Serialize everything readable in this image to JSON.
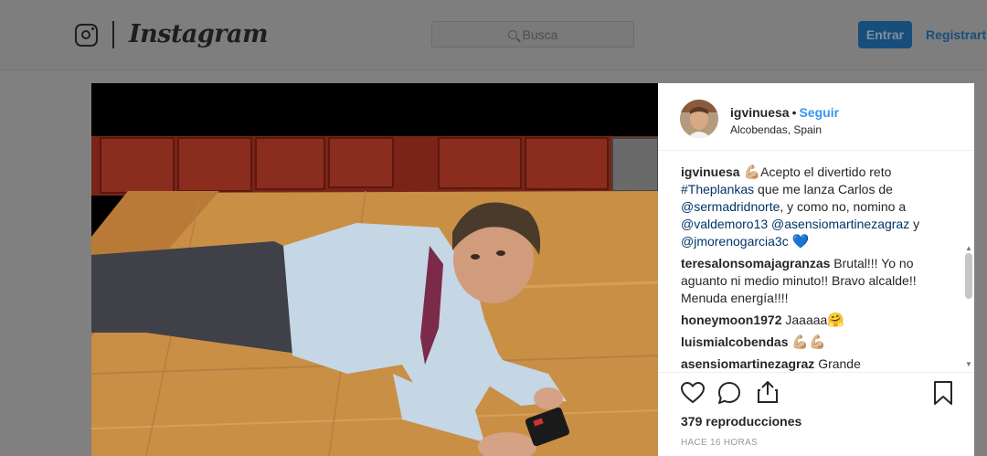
{
  "header": {
    "brand": "Instagram",
    "search_placeholder": "Busca",
    "login_label": "Entrar",
    "register_label": "Registrarte"
  },
  "post": {
    "username": "igvinuesa",
    "separator": "•",
    "follow_label": "Seguir",
    "location": "Alcobendas, Spain",
    "views_count": "379",
    "views_label": "reproducciones",
    "timestamp": "HACE 16 HORAS",
    "caption": {
      "username": "igvinuesa",
      "emoji": "💪🏼",
      "text_1": "Acepto el divertido reto",
      "hashtag": "#Theplankas",
      "text_2": " que me lanza Carlos de",
      "mention_1": "@sermadridnorte",
      "text_3": ", y como no, nomino a",
      "mention_2": "@valdemoro13",
      "mention_3": "@asensiomartinezagraz",
      "text_4": " y",
      "mention_4": "@jmorenogarcia3c",
      "emoji_end": "💙"
    },
    "comments": [
      {
        "username": "teresalonsomajagranzas",
        "text": "Brutal!!! Yo no aguanto ni medio minuto!! Bravo alcalde!! Menuda energía!!!!",
        "emoji": ""
      },
      {
        "username": "honeymoon1972",
        "text": "Jaaaaa",
        "emoji": "🤗"
      },
      {
        "username": "luismialcobendas",
        "text": "",
        "emoji": "💪🏼💪🏼"
      },
      {
        "username": "asensiomartinezagraz",
        "text": "Grande",
        "emoji": ""
      }
    ]
  },
  "icons": {
    "like": "heart-icon",
    "comment": "comment-icon",
    "share": "share-icon",
    "save": "bookmark-icon",
    "logo": "instagram-glyph-icon",
    "search": "search-icon"
  },
  "colors": {
    "follow": "#3897f0",
    "mention": "#003569",
    "login_button": "#3897f0"
  }
}
